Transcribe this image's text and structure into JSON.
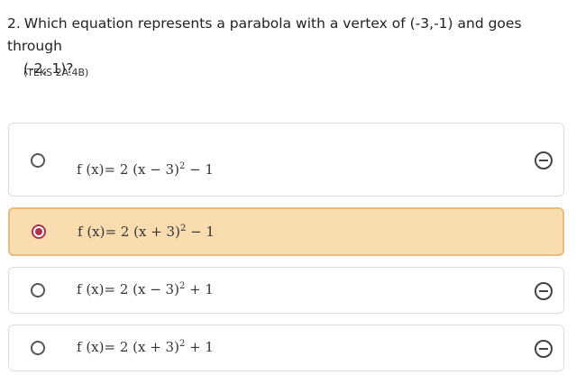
{
  "question": {
    "number": "2.",
    "text_line1": "Which equation represents a parabola with a vertex of (-3,-1) and goes through",
    "text_line2": "(-2, 1)?",
    "standard": "(TEKS 2A.4B)"
  },
  "choices": [
    {
      "lhs": "f (x)= 2 (x − 3)",
      "exp": "2",
      "rhs": " − 1",
      "selected": false,
      "eliminate_icon": "eliminate-icon"
    },
    {
      "lhs": "f (x)= 2 (x + 3)",
      "exp": "2",
      "rhs": " − 1",
      "selected": true
    },
    {
      "lhs": "f (x)= 2 (x − 3)",
      "exp": "2",
      "rhs": " + 1",
      "selected": false,
      "eliminate_icon": "eliminate-icon"
    },
    {
      "lhs": "f (x)= 2 (x + 3)",
      "exp": "2",
      "rhs": " + 1",
      "selected": false,
      "eliminate_icon": "eliminate-icon"
    }
  ],
  "colors": {
    "selected_background": "#f9dcb0",
    "selected_border": "#e8bb7e",
    "radio_checked": "#b03050"
  }
}
